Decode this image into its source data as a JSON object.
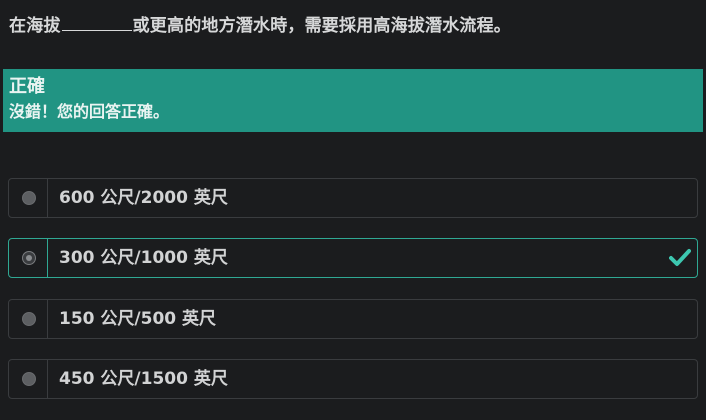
{
  "question": {
    "prefix": "在海拔",
    "suffix": "或更高的地方潛水時，需要採用高海拔潛水流程。"
  },
  "feedback": {
    "title": "正確",
    "message": "沒錯！您的回答正確。",
    "color": "#219483"
  },
  "options": [
    {
      "label": "600 公尺/2000 英尺",
      "selected": false,
      "correct": false
    },
    {
      "label": "300 公尺/1000 英尺",
      "selected": true,
      "correct": true,
      "icon": "checkmark-icon"
    },
    {
      "label": "150 公尺/500 英尺",
      "selected": false,
      "correct": false
    },
    {
      "label": "450 公尺/1500 英尺",
      "selected": false,
      "correct": false
    }
  ],
  "colors": {
    "background": "#1b1c1e",
    "accent": "#2fa893",
    "check": "#3dc7b0"
  }
}
